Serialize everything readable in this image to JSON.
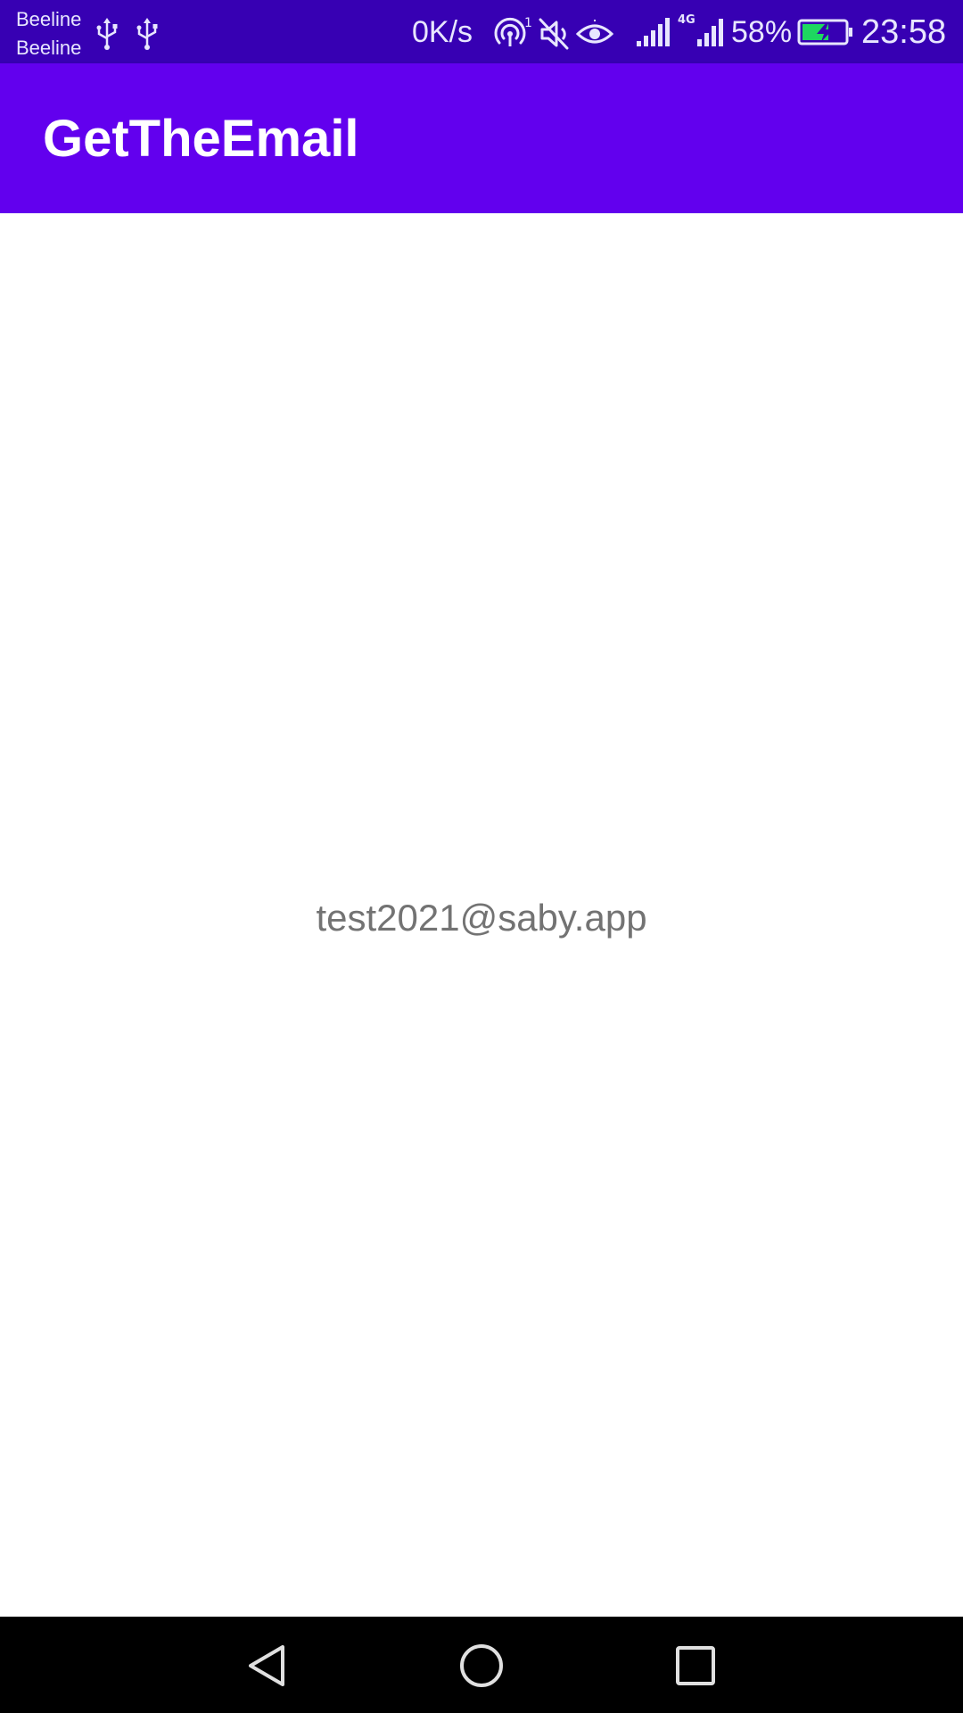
{
  "status_bar": {
    "carrier_1": "Beeline",
    "carrier_2": "Beeline",
    "net_speed": "0K/s",
    "net_type": "4G",
    "battery": "58%",
    "time": "23:58",
    "icons": [
      "usb-icon",
      "usb-icon",
      "hotspot-icon",
      "mute-icon",
      "eye-icon",
      "signal-icon",
      "signal-icon",
      "battery-charging-icon"
    ],
    "background_color": "#3700B3"
  },
  "app_bar": {
    "title": "GetTheEmail",
    "background_color": "#6200EE"
  },
  "content": {
    "email": "test2021@saby.app"
  },
  "nav_bar": {
    "buttons": [
      "back-icon",
      "home-icon",
      "recents-icon"
    ]
  }
}
